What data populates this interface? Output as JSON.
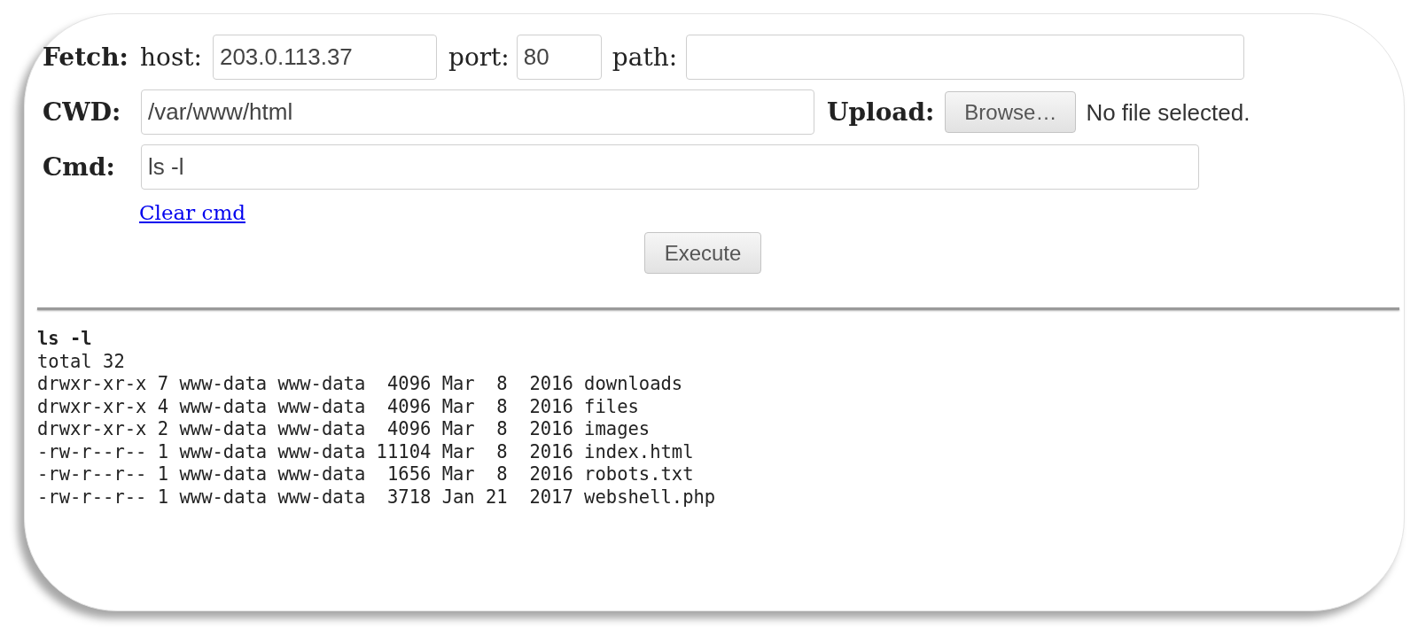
{
  "fetch": {
    "label": "Fetch:",
    "host": {
      "label": "host:",
      "value": "203.0.113.37"
    },
    "port": {
      "label": "port:",
      "value": "80"
    },
    "path": {
      "label": "path:"
    }
  },
  "cwd": {
    "label": "CWD:",
    "value": "/var/www/html"
  },
  "upload": {
    "label": "Upload:",
    "button": "Browse…",
    "status": "No file selected."
  },
  "cmd": {
    "label": "Cmd:",
    "value": "ls -l",
    "clear_link": "Clear cmd"
  },
  "execute_button": "Execute",
  "output": {
    "command": "ls -l",
    "lines": [
      "total 32",
      "drwxr-xr-x 7 www-data www-data  4096 Mar  8  2016 downloads",
      "drwxr-xr-x 4 www-data www-data  4096 Mar  8  2016 files",
      "drwxr-xr-x 2 www-data www-data  4096 Mar  8  2016 images",
      "-rw-r--r-- 1 www-data www-data 11104 Mar  8  2016 index.html",
      "-rw-r--r-- 1 www-data www-data  1656 Mar  8  2016 robots.txt",
      "-rw-r--r-- 1 www-data www-data  3718 Jan 21  2017 webshell.php"
    ]
  }
}
